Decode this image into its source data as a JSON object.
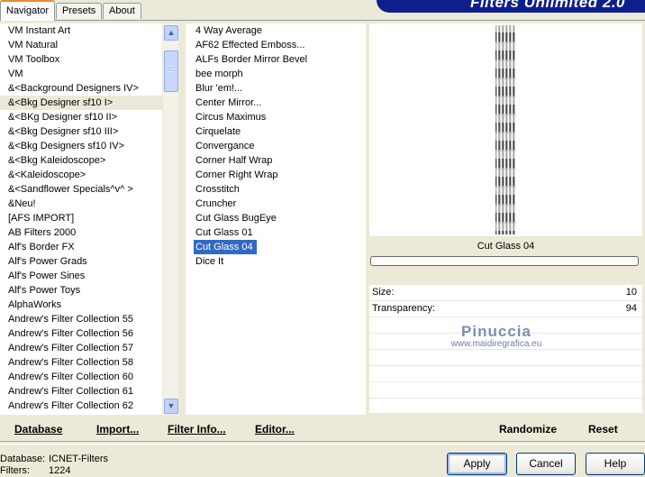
{
  "tabs": [
    "Navigator",
    "Presets",
    "About"
  ],
  "banner_title": "Filters Unlimited 2.0",
  "categories": [
    "VM Instant Art",
    "VM Natural",
    "VM Toolbox",
    "VM",
    "&<Background Designers IV>",
    "&<Bkg Designer sf10 I>",
    "&<BKg Designer sf10 II>",
    "&<Bkg Designer sf10 III>",
    "&<Bkg Designers sf10 IV>",
    "&<Bkg Kaleidoscope>",
    "&<Kaleidoscope>",
    "&<Sandflower Specials^v^ >",
    "&Neu!",
    "[AFS IMPORT]",
    "AB Filters 2000",
    "Alf's Border FX",
    "Alf's Power Grads",
    "Alf's Power Sines",
    "Alf's Power Toys",
    "AlphaWorks",
    "Andrew's Filter Collection 55",
    "Andrew's Filter Collection 56",
    "Andrew's Filter Collection 57",
    "Andrew's Filter Collection 58",
    "Andrew's Filter Collection 60",
    "Andrew's Filter Collection 61",
    "Andrew's Filter Collection 62"
  ],
  "selected_category_index": 5,
  "filters": [
    "4 Way Average",
    "AF62 Effected Emboss...",
    "ALFs Border Mirror Bevel",
    "bee morph",
    "Blur 'em!...",
    "Center Mirror...",
    "Circus Maximus",
    "Cirquelate",
    "Convergance",
    "Corner Half Wrap",
    "Corner Right Wrap",
    "Crosstitch",
    "Cruncher",
    "Cut Glass  BugEye",
    "Cut Glass 01",
    "Cut Glass 04",
    "Dice It"
  ],
  "selected_filter_index": 15,
  "preview": {
    "filter_name": "Cut Glass 04"
  },
  "params": [
    {
      "label": "Size:",
      "value": "10"
    },
    {
      "label": "Transparency:",
      "value": "94"
    }
  ],
  "watermark": {
    "line1": "Pinuccia",
    "line2": "www.maidiregrafica.eu"
  },
  "toolbar": {
    "database": "Database",
    "import": "Import...",
    "filter_info": "Filter Info...",
    "editor": "Editor...",
    "randomize": "Randomize",
    "reset": "Reset"
  },
  "status": {
    "database_label": "Database:",
    "database_value": "ICNET-Filters",
    "filters_label": "Filters:",
    "filters_value": "1224"
  },
  "buttons": {
    "apply": "Apply",
    "cancel": "Cancel",
    "help": "Help"
  },
  "icons": {
    "scroll_up": "scroll-up-arrow",
    "scroll_down": "scroll-down-arrow"
  }
}
